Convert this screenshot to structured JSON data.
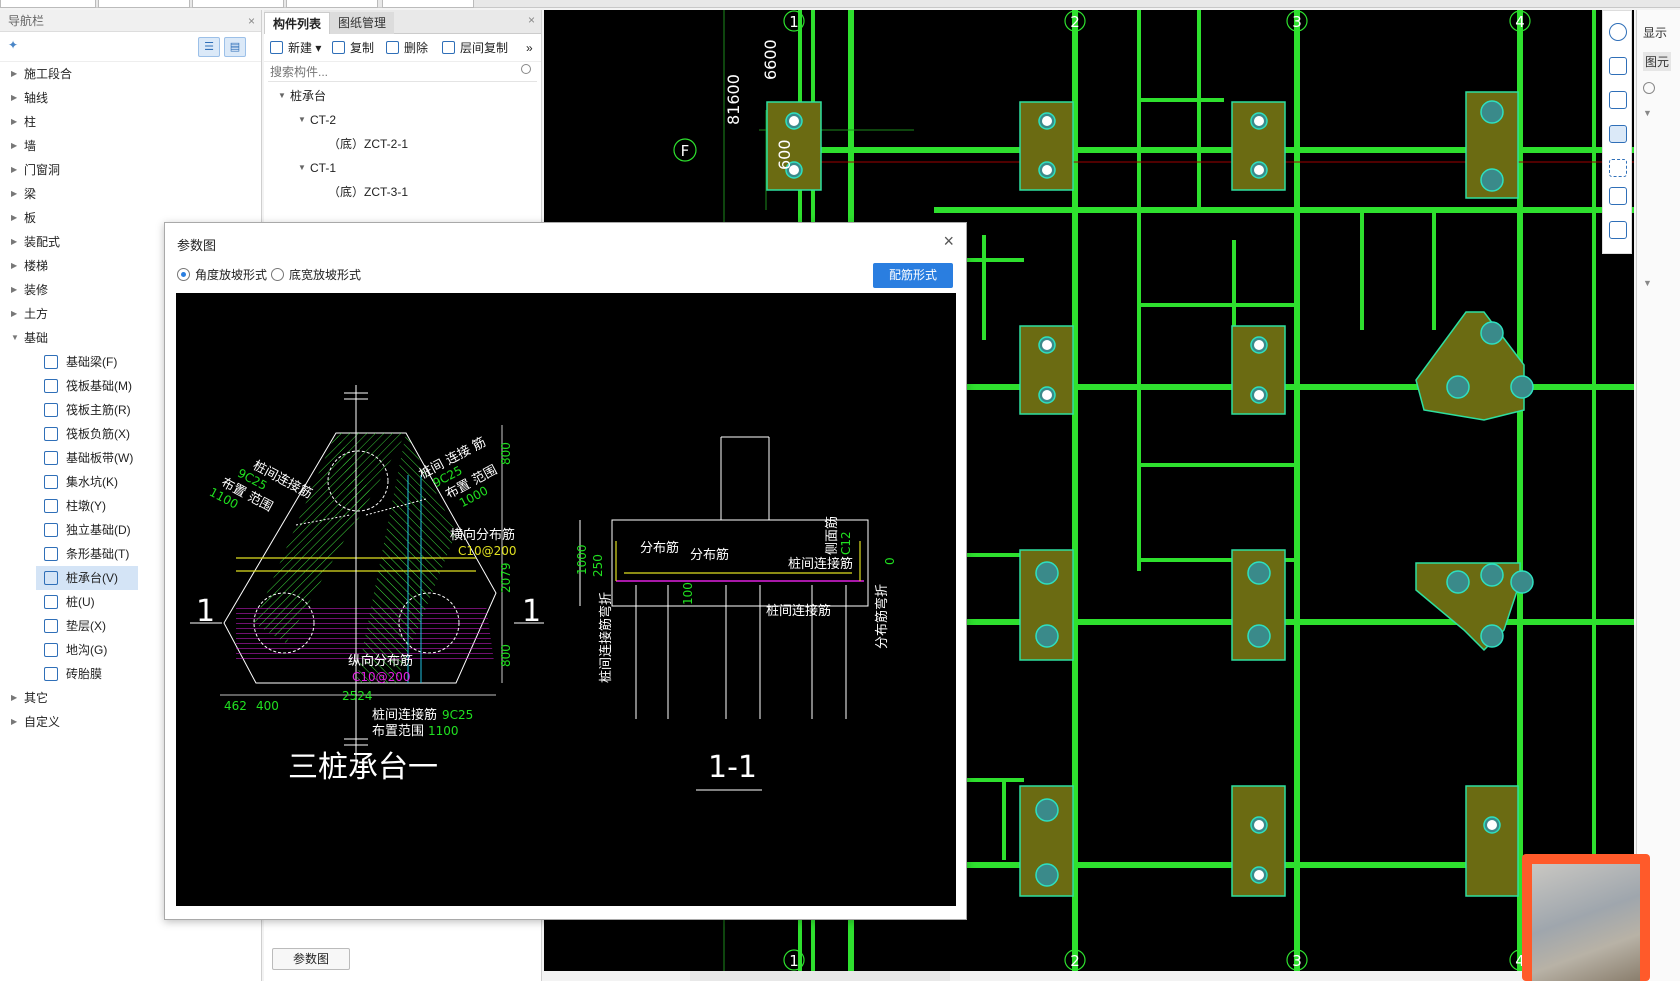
{
  "nav": {
    "title": "导航栏",
    "close": "×",
    "items": [
      {
        "label": "施工段合"
      },
      {
        "label": "轴线"
      },
      {
        "label": "柱"
      },
      {
        "label": "墙"
      },
      {
        "label": "门窗洞"
      },
      {
        "label": "梁"
      },
      {
        "label": "板"
      },
      {
        "label": "装配式"
      },
      {
        "label": "楼梯"
      },
      {
        "label": "装修"
      },
      {
        "label": "土方"
      },
      {
        "label": "基础"
      }
    ],
    "foundation_children": [
      {
        "label": "基础梁(F)",
        "icon": "foundation-beam-icon"
      },
      {
        "label": "筏板基础(M)",
        "icon": "raft-foundation-icon"
      },
      {
        "label": "筏板主筋(R)",
        "icon": "raft-main-rebar-icon"
      },
      {
        "label": "筏板负筋(X)",
        "icon": "raft-negative-rebar-icon"
      },
      {
        "label": "基础板带(W)",
        "icon": "foundation-strip-icon"
      },
      {
        "label": "集水坑(K)",
        "icon": "sump-pit-icon"
      },
      {
        "label": "柱墩(Y)",
        "icon": "column-pier-icon"
      },
      {
        "label": "独立基础(D)",
        "icon": "isolated-footing-icon"
      },
      {
        "label": "条形基础(T)",
        "icon": "strip-footing-icon"
      },
      {
        "label": "桩承台(V)",
        "icon": "pile-cap-icon"
      },
      {
        "label": "桩(U)",
        "icon": "pile-icon"
      },
      {
        "label": "垫层(X)",
        "icon": "cushion-layer-icon"
      },
      {
        "label": "地沟(G)",
        "icon": "trench-icon"
      },
      {
        "label": "砖胎膜",
        "icon": "brick-formwork-icon"
      }
    ],
    "after_items": [
      {
        "label": "其它"
      },
      {
        "label": "自定义"
      }
    ]
  },
  "comp": {
    "tab_list": "构件列表",
    "tab_drawings": "图纸管理",
    "close": "×",
    "toolbar": {
      "new": "新建",
      "copy": "复制",
      "delete": "删除",
      "floor_copy": "层间复制",
      "more": "»"
    },
    "search_placeholder": "搜索构件...",
    "tree": {
      "root": "桩承台",
      "ct2": "CT-2",
      "ct2_child": "（底）ZCT-2-1",
      "ct1": "CT-1",
      "ct1_child": "（底）ZCT-3-1"
    },
    "param_button": "参数图"
  },
  "dialog": {
    "title": "参数图",
    "close": "×",
    "radio_angle": "角度放坡形式",
    "radio_width": "底宽放坡形式",
    "selected": "angle",
    "rebar_button": "配筋形式",
    "drawing": {
      "left_title": "三桩承台一",
      "right_title": "1-1",
      "section_mark": "1",
      "lbl_link_left": "桩间连接筋",
      "lbl_link_left_val": "9C25",
      "lbl_range_left": "布置 范围",
      "lbl_range_left_val": "1100",
      "lbl_link_right": "桩间 连接 筋",
      "lbl_link_right_val": "9C25",
      "lbl_range_right": "布置 范围",
      "lbl_range_right_val": "1000",
      "lbl_transverse": "横向分布筋",
      "lbl_transverse_val": "C10@200",
      "lbl_longit": "纵向分布筋",
      "lbl_longit_val": "C10@200",
      "lbl_bottom_link": "桩间连接筋",
      "lbl_bottom_link_val": "9C25",
      "lbl_bottom_range": "布置范围",
      "lbl_bottom_range_val": "1100",
      "dim_800_top": "800",
      "dim_2079": "2079",
      "dim_800_bot": "800",
      "dim_462": "462",
      "dim_400": "400",
      "dim_2524": "2524",
      "sec_dist1": "分布筋",
      "sec_dist2": "分布筋",
      "sec_side": "侧面筋",
      "sec_side_val": "C12",
      "sec_link": "桩间连接筋",
      "sec_link_bottom": "桩间连接筋",
      "sec_left_vert": "桩间连接筋弯折",
      "sec_right_vert": "分布筋弯折",
      "sec_1000": "1000",
      "sec_250": "250",
      "sec_100": "100",
      "sec_0": "0"
    }
  },
  "cad": {
    "axes_top": [
      "1",
      "2",
      "3",
      "4"
    ],
    "axes_bottom": [
      "1",
      "2",
      "3",
      "4"
    ],
    "row_label": "F",
    "dim_81600": "81600",
    "dim_6600": "6600",
    "dim_600": "600"
  },
  "right_panel": {
    "label1": "显示",
    "label2": "图元"
  },
  "colors": {
    "accent": "#2a7ee0",
    "cad_green": "#2ee02e",
    "cad_cap": "#6b6b12",
    "cad_bg": "#000000"
  }
}
